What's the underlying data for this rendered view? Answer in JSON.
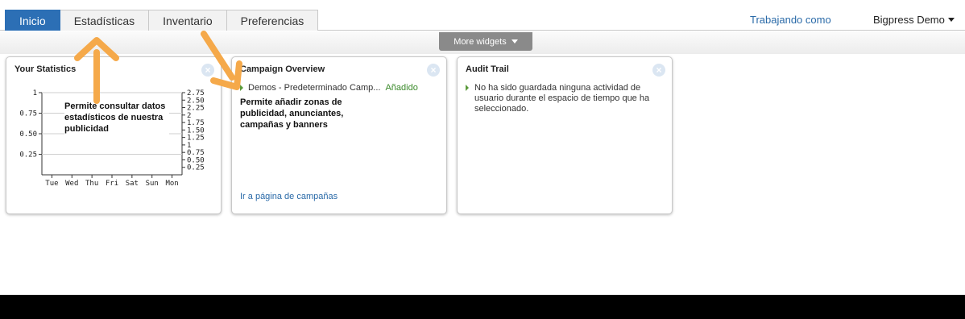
{
  "nav": {
    "tabs": [
      {
        "label": "Inicio",
        "active": true
      },
      {
        "label": "Estadísticas"
      },
      {
        "label": "Inventario"
      },
      {
        "label": "Preferencias"
      }
    ],
    "working_as": "Trabajando como",
    "user": "Bigpress Demo"
  },
  "more_widgets": "More widgets",
  "widgets": {
    "stats": {
      "title": "Your Statistics",
      "note": "Permite consultar datos estadísticos de nuestra publicidad"
    },
    "campaign": {
      "title": "Campaign Overview",
      "item": "Demos - Predeterminado Camp...",
      "status": "Añadido",
      "note": "Permite añadir zonas de publicidad, anunciantes, campañas y banners",
      "link": "Ir a página de campañas"
    },
    "audit": {
      "title": "Audit Trail",
      "text": "No ha sido guardada ninguna actividad de usuario durante el espacio de tiempo que ha seleccionado."
    }
  },
  "chart_data": {
    "type": "line",
    "categories": [
      "Tue",
      "Wed",
      "Thu",
      "Fri",
      "Sat",
      "Sun",
      "Mon"
    ],
    "series": [],
    "left_ticks": [
      "1",
      "0.75",
      "0.50",
      "0.25"
    ],
    "right_ticks": [
      "2.75",
      "2.50",
      "2.25",
      "2",
      "1.75",
      "1.50",
      "1.25",
      "1",
      "0.75",
      "0.50",
      "0.25"
    ],
    "ylim": [
      0,
      1
    ],
    "ylim_right": [
      0,
      2.75
    ],
    "grid": true
  },
  "colors": {
    "accent": "#2c6fb5",
    "link": "#2a6aa8",
    "arrow": "#f5a94a",
    "added": "#3b8a2b"
  }
}
